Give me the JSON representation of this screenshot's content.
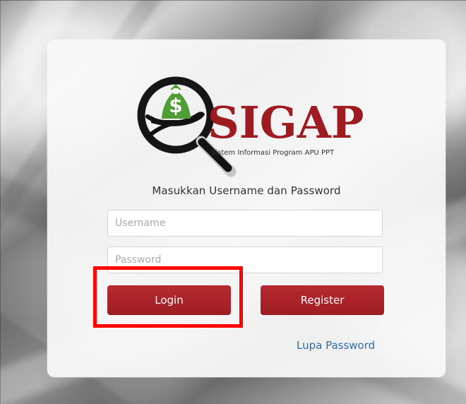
{
  "logo": {
    "title": "SIGAP",
    "subtitle": "Sistem Informasi Program APU PPT",
    "symbol": "$",
    "icon": "magnifier-hand-money-icon",
    "colors": {
      "brand_red": "#9f1b22",
      "black": "#161616",
      "green": "#51a33a"
    }
  },
  "form": {
    "instruction": "Masukkan Username dan Password",
    "username_placeholder": "Username",
    "password_placeholder": "Password",
    "login_label": "Login",
    "register_label": "Register",
    "forgot_password_label": "Lupa Password"
  },
  "colors": {
    "button_red": "#a9242a",
    "link_blue": "#2f6ca3",
    "highlight_red": "#ff0000"
  }
}
